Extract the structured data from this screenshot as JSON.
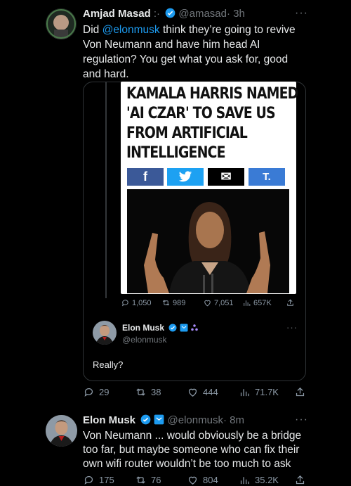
{
  "tweet1": {
    "author_name": "Amjad Masad",
    "author_extra": ":·",
    "handle": "@amasad",
    "time": "· 3h",
    "text_prefix": "Did ",
    "mention": "@elonmusk",
    "text_rest_line1": " think they’re going to revive",
    "text_line2": "Von Neumann and have him head AI",
    "text_line3": "regulation? You get what you ask for, good",
    "text_line4": "and hard.",
    "more": "···"
  },
  "embedded_article": {
    "headline_line1": "KAMALA HARRIS NAMED",
    "headline_line2": "'AI CZAR' TO SAVE US",
    "headline_line3": "FROM ARTIFICIAL",
    "headline_line4": "INTELLIGENCE",
    "share_buttons": [
      {
        "label": "f",
        "color": "#3b5998"
      },
      {
        "label": "🐦",
        "color": "#1da1f2"
      },
      {
        "label": "✉",
        "color": "#000000"
      },
      {
        "label": "T.",
        "color": "#3a7bd5"
      }
    ],
    "metrics": {
      "replies": "1,050",
      "retweets": "989",
      "likes": "7,051",
      "views": "657K"
    }
  },
  "quoted_reply": {
    "author_name": "Elon Musk",
    "handle": "@elonmusk",
    "text": "Really?",
    "more": "···"
  },
  "tweet1_metrics": {
    "replies": "29",
    "retweets": "38",
    "likes": "444",
    "views": "71.7K"
  },
  "tweet2": {
    "author_name": "Elon Musk",
    "handle": "@elonmusk",
    "time": "· 8m",
    "text_line1": "Von Neumann ... would obviously be a bridge",
    "text_line2": "too far, but maybe someone who can fix their",
    "text_line3": "own wifi router wouldn’t be too much to ask",
    "more": "···",
    "metrics": {
      "replies": "175",
      "retweets": "76",
      "likes": "804",
      "views": "35.2K"
    }
  }
}
